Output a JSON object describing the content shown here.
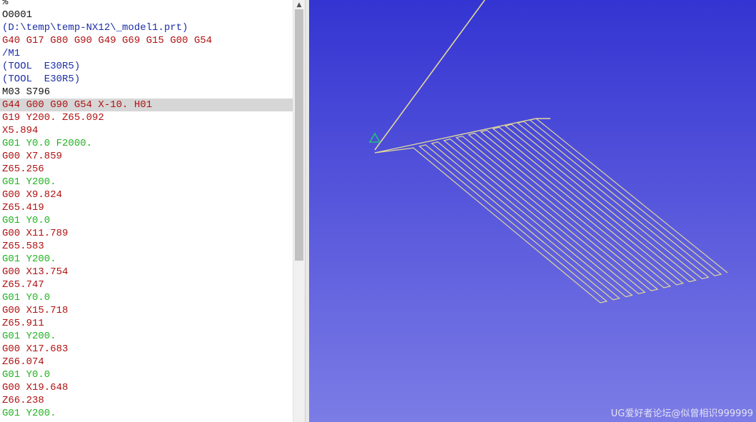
{
  "editor": {
    "lines": [
      {
        "text": "%",
        "color": "#111111"
      },
      {
        "text": "O0001",
        "color": "#111111"
      },
      {
        "text": "(D:\\temp\\temp-NX12\\_model1.prt)",
        "color": "#1c2fa6"
      },
      {
        "text": "G40 G17 G80 G90 G49 G69 G15 G00 G54",
        "color": "#b01212"
      },
      {
        "text": "/M1",
        "color": "#1c2fa6"
      },
      {
        "text": "(TOOL  E30R5)",
        "color": "#1c2fa6"
      },
      {
        "text": "(TOOL  E30R5)",
        "color": "#1c2fa6"
      },
      {
        "text": "M03 S796",
        "color": "#111111"
      },
      {
        "text": "G44 G00 G90 G54 X-10. H01",
        "color": "#b01212",
        "highlighted": true
      },
      {
        "text": "G19 Y200. Z65.092",
        "color": "#b01212"
      },
      {
        "text": "X5.894",
        "color": "#b01212"
      },
      {
        "text": "G01 Y0.0 F2000.",
        "color": "#22b322"
      },
      {
        "text": "G00 X7.859",
        "color": "#b01212"
      },
      {
        "text": "Z65.256",
        "color": "#b01212"
      },
      {
        "text": "G01 Y200.",
        "color": "#22b322"
      },
      {
        "text": "G00 X9.824",
        "color": "#b01212"
      },
      {
        "text": "Z65.419",
        "color": "#b01212"
      },
      {
        "text": "G01 Y0.0",
        "color": "#22b322"
      },
      {
        "text": "G00 X11.789",
        "color": "#b01212"
      },
      {
        "text": "Z65.583",
        "color": "#b01212"
      },
      {
        "text": "G01 Y200.",
        "color": "#22b322"
      },
      {
        "text": "G00 X13.754",
        "color": "#b01212"
      },
      {
        "text": "Z65.747",
        "color": "#b01212"
      },
      {
        "text": "G01 Y0.0",
        "color": "#22b322"
      },
      {
        "text": "G00 X15.718",
        "color": "#b01212"
      },
      {
        "text": "Z65.911",
        "color": "#b01212"
      },
      {
        "text": "G01 Y200.",
        "color": "#22b322"
      },
      {
        "text": "G00 X17.683",
        "color": "#b01212"
      },
      {
        "text": "Z66.074",
        "color": "#b01212"
      },
      {
        "text": "G01 Y0.0",
        "color": "#22b322"
      },
      {
        "text": "G00 X19.648",
        "color": "#b01212"
      },
      {
        "text": "Z66.238",
        "color": "#b01212"
      },
      {
        "text": "G01 Y200.",
        "color": "#22b322"
      }
    ]
  },
  "scrollbar": {
    "up_icon": "scroll-up-arrow-icon",
    "thumb_fraction": 0.6
  },
  "viewport": {
    "background_top": "#3434d2",
    "background_bottom": "#7c7ce6",
    "toolpath_color": "#e0d79a",
    "start_marker_color": "#22c27a",
    "start_marker_icon": "triangle-icon",
    "watermark": "UG爱好者论坛@似曾相识999999"
  }
}
